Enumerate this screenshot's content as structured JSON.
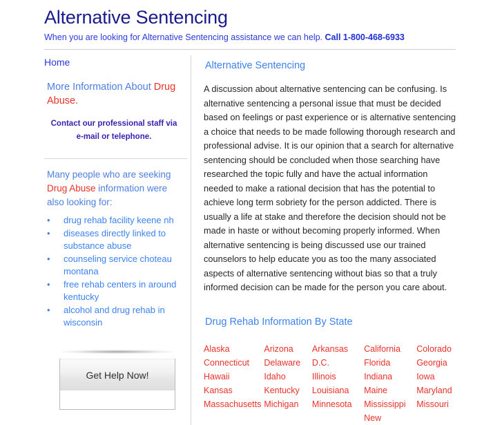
{
  "header": {
    "site_title": "Alternative Sentencing",
    "tagline_text": "When you are looking for Alternative Sentencing assistance we can help.",
    "tagline_phone": "Call 1-800-468-6933",
    "title_color": "#1a1a8c",
    "link_color": "#2b39d8"
  },
  "sidebar": {
    "home_label": "Home",
    "more_info_prefix": "More Information About ",
    "more_info_highlight": "Drug Abuse.",
    "contact_note_line1": "Contact our professional staff via",
    "contact_note_line2": "e-mail or telephone.",
    "seeking_line1": "Many people who are seeking ",
    "seeking_highlight": "Drug Abuse",
    "seeking_line2": " information were also looking for:",
    "keywords": [
      "drug rehab facility keene nh",
      "diseases directly linked to substance abuse",
      "counseling service choteau montana",
      "free rehab centers in around kentucky",
      "alcohol and drug rehab in wisconsin"
    ],
    "bullet_glyph": "•",
    "accent_red": "#e8312a",
    "accent_blue": "#3d82f0"
  },
  "cta": {
    "label": "Get Help Now!"
  },
  "content": {
    "heading": "Alternative Sentencing",
    "article": "A discussion about alternative sentencing can be confusing. Is alternative sentencing a personal issue that must be decided based on feelings or past experience or is alternative sentencing a choice that needs to be made following thorough research and professional advise. It is our opinion that a search for alternative sentencing should be concluded when those searching have researched the topic fully and have the actual information needed to make a rational decision that has the potential to achieve long term sobriety for the person addicted. There is usually a life at stake and therefore the decision should not be made in haste or without becoming properly informed. When alternative sentencing is being discussed use our trained counselors to help educate you as too the many associated aspects of alternative sentencing without bias so that a truly informed decision can be made for the person you care about.",
    "states_heading": "Drug Rehab Information By State",
    "state_rows": [
      [
        "Alaska",
        "Arizona",
        "Arkansas",
        "California",
        "Colorado"
      ],
      [
        "Connecticut",
        "Delaware",
        "D.C.",
        "Florida",
        "Georgia"
      ],
      [
        "Hawaii",
        "Idaho",
        "Illinois",
        "Indiana",
        "Iowa"
      ],
      [
        "Kansas",
        "Kentucky",
        "Louisiana",
        "Maine",
        "Maryland"
      ],
      [
        "Massachusetts",
        "Michigan",
        "Minnesota",
        "Mississippi",
        "Missouri"
      ],
      [
        "",
        "",
        "",
        "New",
        ""
      ]
    ]
  }
}
